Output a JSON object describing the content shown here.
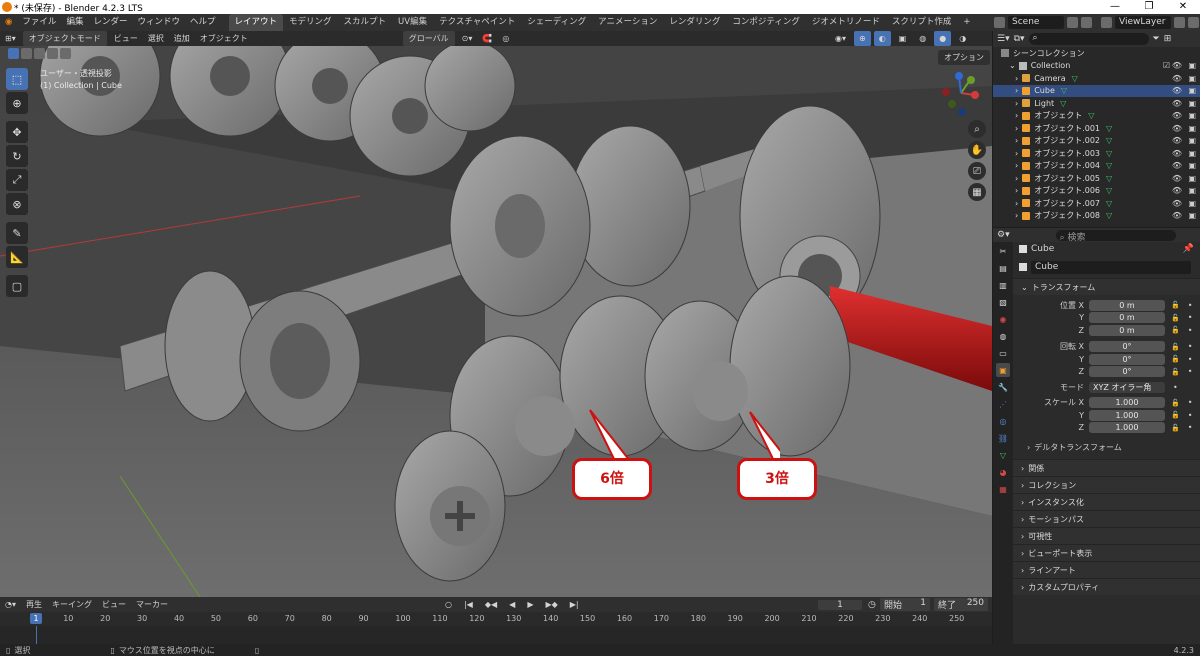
{
  "window": {
    "title": "* (未保存) - Blender 4.2.3 LTS",
    "minimize": "—",
    "maximize": "❐",
    "close": "✕"
  },
  "menus": [
    "ファイル",
    "編集",
    "レンダー",
    "ウィンドウ",
    "ヘルプ"
  ],
  "workspaces": [
    "レイアウト",
    "モデリング",
    "スカルプト",
    "UV編集",
    "テクスチャペイント",
    "シェーディング",
    "アニメーション",
    "レンダリング",
    "コンポジティング",
    "ジオメトリノード",
    "スクリプト作成"
  ],
  "scene": {
    "name": "Scene",
    "viewlayer": "ViewLayer"
  },
  "viewport_header": {
    "mode": "オブジェクトモード",
    "items": [
      "ビュー",
      "選択",
      "追加",
      "オブジェクト"
    ],
    "orientation": "グローバル",
    "options": "オプション"
  },
  "overlay": {
    "line1": "ユーザー・透視投影",
    "line2": "(1) Collection | Cube"
  },
  "callouts": [
    {
      "label": "6倍"
    },
    {
      "label": "3倍"
    }
  ],
  "outliner": {
    "search_placeholder": "",
    "scene_collection": "シーンコレクション",
    "collection": "Collection",
    "items": [
      {
        "name": "Camera",
        "type": "camera",
        "selected": false
      },
      {
        "name": "Cube",
        "type": "mesh",
        "selected": true
      },
      {
        "name": "Light",
        "type": "light",
        "selected": false
      },
      {
        "name": "オブジェクト",
        "type": "mesh",
        "selected": false
      },
      {
        "name": "オブジェクト.001",
        "type": "mesh",
        "selected": false
      },
      {
        "name": "オブジェクト.002",
        "type": "mesh",
        "selected": false
      },
      {
        "name": "オブジェクト.003",
        "type": "mesh",
        "selected": false
      },
      {
        "name": "オブジェクト.004",
        "type": "mesh",
        "selected": false
      },
      {
        "name": "オブジェクト.005",
        "type": "mesh",
        "selected": false
      },
      {
        "name": "オブジェクト.006",
        "type": "mesh",
        "selected": false
      },
      {
        "name": "オブジェクト.007",
        "type": "mesh",
        "selected": false
      },
      {
        "name": "オブジェクト.008",
        "type": "mesh",
        "selected": false
      }
    ]
  },
  "properties": {
    "search_placeholder": "検索",
    "object_name": "Cube",
    "object_field": "Cube",
    "transform_title": "トランスフォーム",
    "location": {
      "x_label": "位置 X",
      "y_label": "Y",
      "z_label": "Z",
      "x": "0 m",
      "y": "0 m",
      "z": "0 m"
    },
    "rotation": {
      "x_label": "回転 X",
      "y_label": "Y",
      "z_label": "Z",
      "x": "0°",
      "y": "0°",
      "z": "0°"
    },
    "mode_label": "モード",
    "mode": "XYZ オイラー角",
    "scale": {
      "x_label": "スケール X",
      "y_label": "Y",
      "z_label": "Z",
      "x": "1.000",
      "y": "1.000",
      "z": "1.000"
    },
    "delta_transform": "デルタトランスフォーム",
    "panels": [
      "関係",
      "コレクション",
      "インスタンス化",
      "モーションパス",
      "可視性",
      "ビューポート表示",
      "ラインアート",
      "カスタムプロパティ"
    ]
  },
  "timeline": {
    "playback": "再生",
    "keying": "キーイング",
    "view": "ビュー",
    "marker": "マーカー",
    "current_frame": "1",
    "start_label": "開始",
    "start": "1",
    "end_label": "終了",
    "end": "250",
    "ticks": [
      "1",
      "10",
      "20",
      "30",
      "40",
      "50",
      "60",
      "70",
      "80",
      "90",
      "100",
      "110",
      "120",
      "130",
      "140",
      "150",
      "160",
      "170",
      "180",
      "190",
      "200",
      "210",
      "220",
      "230",
      "240",
      "250"
    ]
  },
  "status": {
    "select": "選択",
    "hint": "マウス位置を視点の中心に",
    "version": "4.2.3"
  },
  "colors": {
    "accent": "#4772b3",
    "callout": "#cc1111",
    "axis_red": "#d23b3b",
    "rod": "#b51010"
  }
}
